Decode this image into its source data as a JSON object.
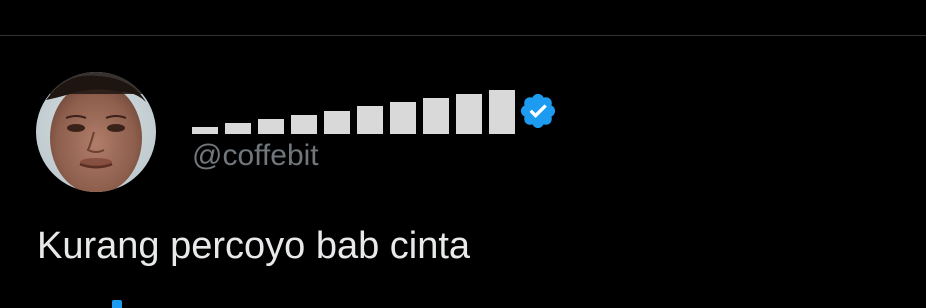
{
  "tweet": {
    "display_name_bar_count": 10,
    "handle": "@coffebit",
    "verified": true,
    "text": "Kurang percoyo bab cinta"
  },
  "colors": {
    "background": "#000000",
    "divider": "#2f3336",
    "name_bars": "#d9d9d9",
    "handle": "#71767b",
    "text": "#e7e9ea",
    "verified_badge": "#1d9bf0"
  },
  "icons": {
    "badge": "verified-badge-icon"
  }
}
